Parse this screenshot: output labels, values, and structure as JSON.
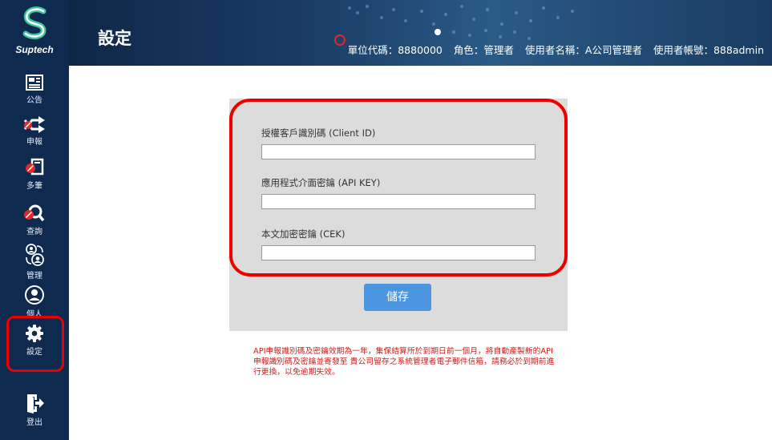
{
  "brand": {
    "name": "Suptech"
  },
  "sidebar": {
    "items": [
      {
        "label": "公告",
        "icon": "newspaper-icon"
      },
      {
        "label": "申報",
        "icon": "shuffle-icon"
      },
      {
        "label": "多筆",
        "icon": "files-icon"
      },
      {
        "label": "查詢",
        "icon": "magnifier-icon"
      },
      {
        "label": "管理",
        "icon": "users-cycle-icon"
      },
      {
        "label": "個人",
        "icon": "user-circle-icon"
      },
      {
        "label": "設定",
        "icon": "gear-icon",
        "active": true
      },
      {
        "label": "登出",
        "icon": "logout-icon"
      }
    ]
  },
  "header": {
    "title": "設定",
    "unit_code": "單位代碼：8880000",
    "role": "角色：管理者",
    "user_name": "使用者名稱：A公司管理者",
    "account": "使用者帳號：888admin"
  },
  "form": {
    "client_id_label": "授權客戶識別碼 (Client ID)",
    "client_id_value": "",
    "api_key_label": "應用程式介面密鑰 (API KEY)",
    "api_key_value": "",
    "cek_label": "本文加密密鑰 (CEK)",
    "cek_value": "",
    "save_label": "儲存"
  },
  "notice": "API申報識別碼及密鑰效期為一年，集保結算所於到期日前一個月，將自動產製新的API申報識別碼及密鑰並寄發至 貴公司留存之系統管理者電子郵件信箱，請務必於到期前進行更換，以免逾期失效。",
  "colors": {
    "sidebar": "#0e2a4e",
    "accent": "#4c95e0",
    "highlight": "#e00000",
    "notice": "#cc1d1d"
  }
}
